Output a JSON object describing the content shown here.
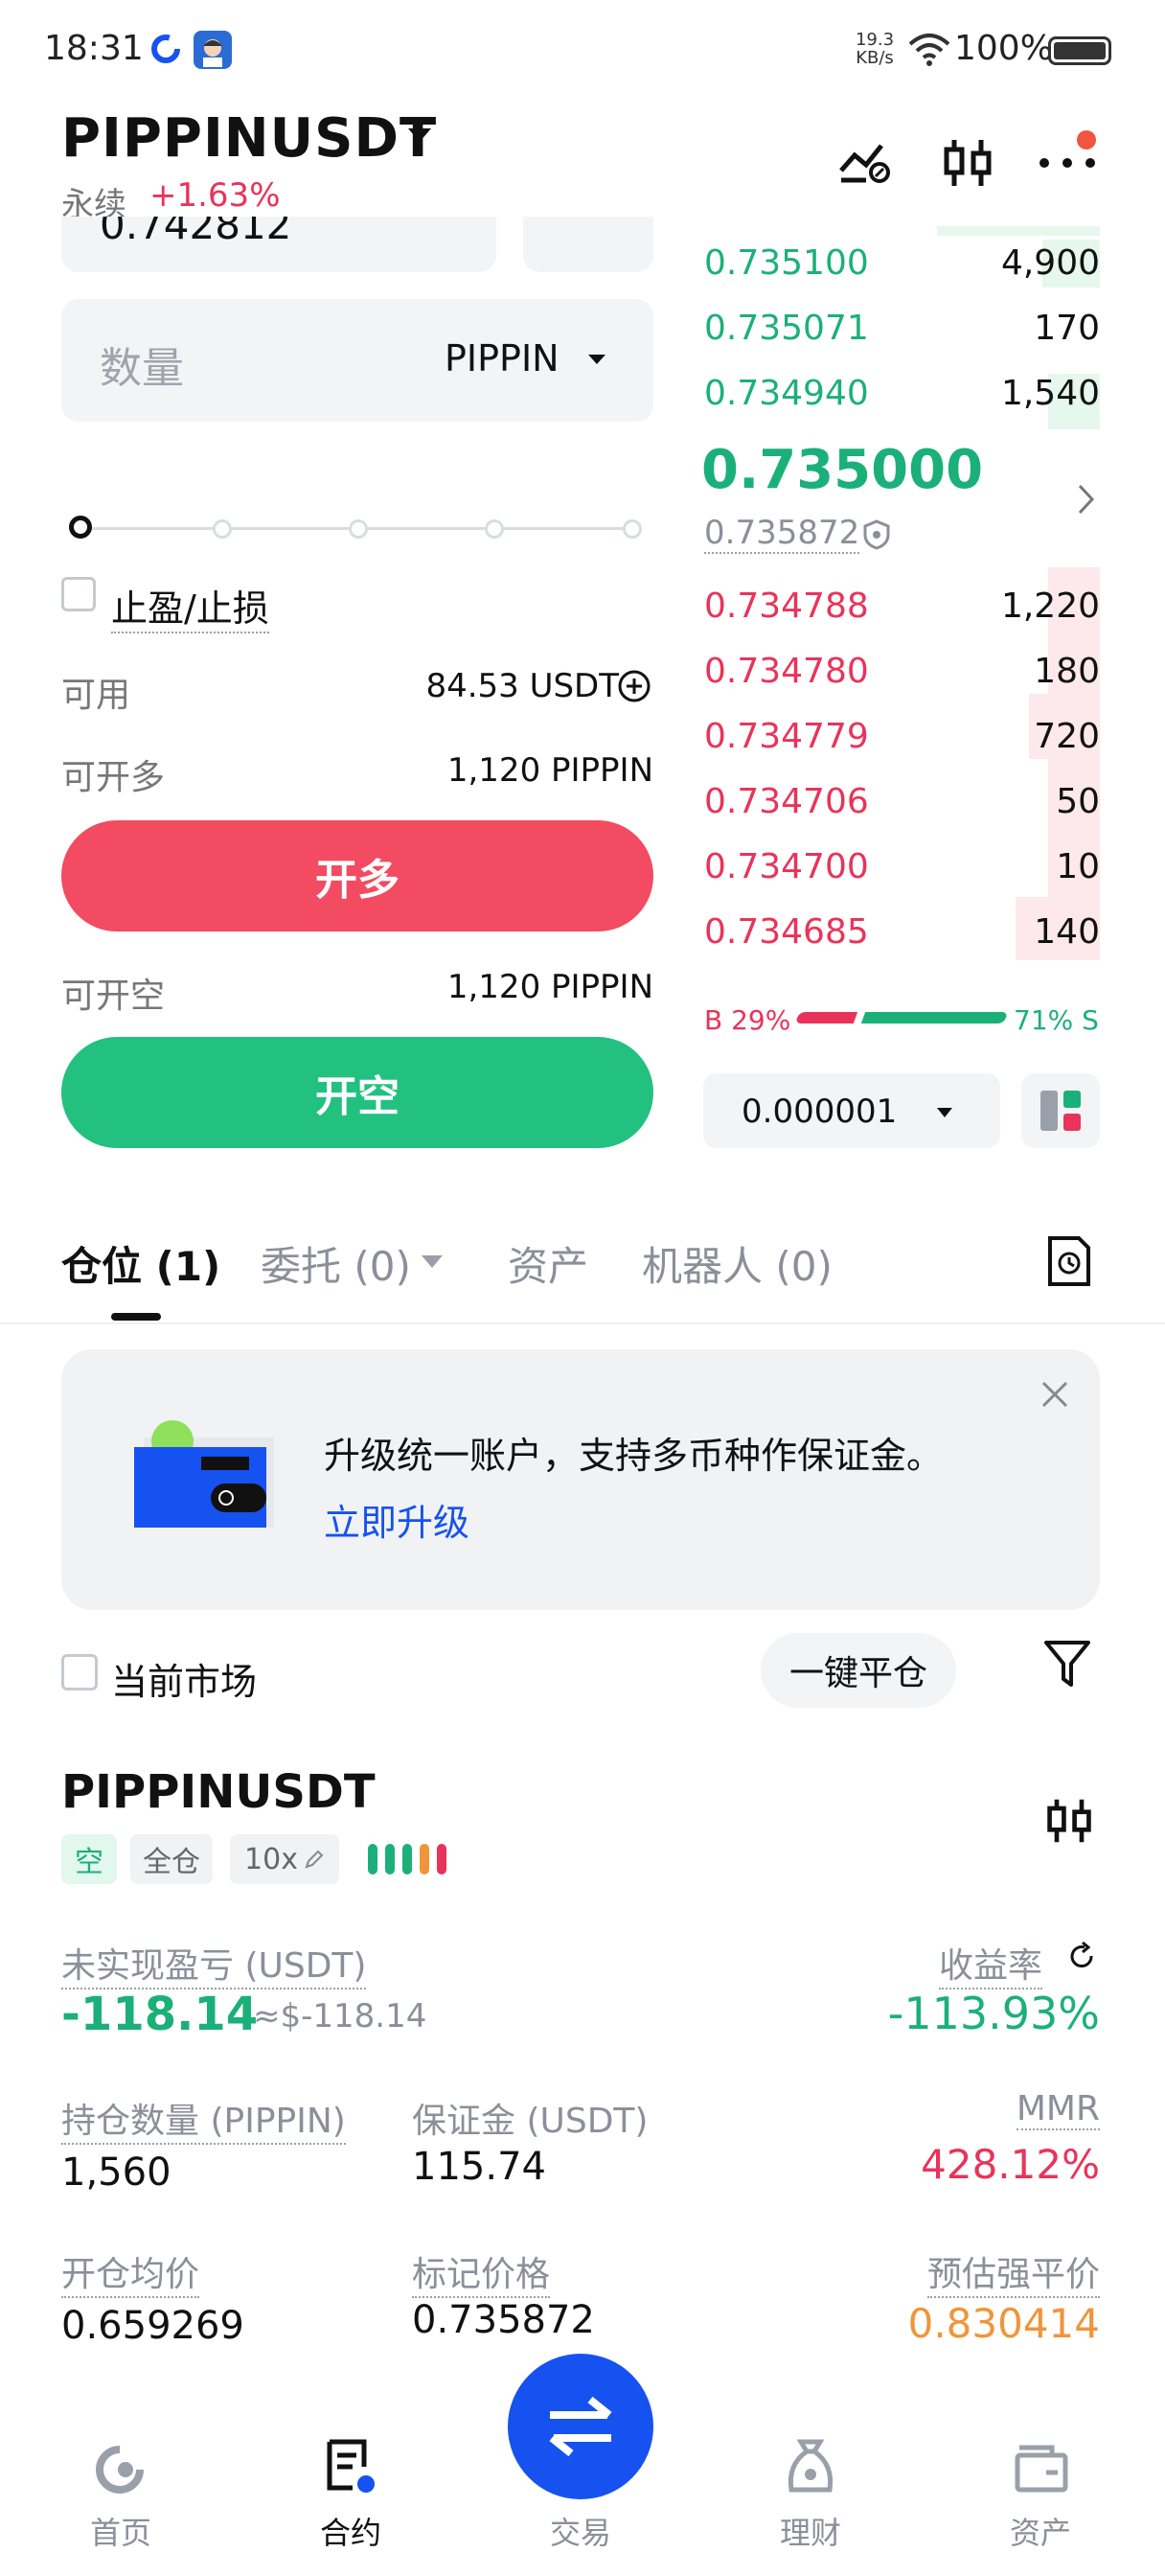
{
  "status": {
    "time": "18:31",
    "speed_top": "19.3",
    "speed_unit": "KB/s",
    "battery": "100%"
  },
  "header": {
    "pair": "PIPPINUSDT",
    "perp_label": "永续",
    "change": "+1.63%"
  },
  "form": {
    "price_partial": "0.742812",
    "qty_placeholder": "数量",
    "qty_unit": "PIPPIN",
    "tpsl_label": "止盈/止损",
    "available_label": "可用",
    "available_value": "84.53 USDT",
    "can_long_label": "可开多",
    "can_long_value": "1,120 PIPPIN",
    "long_button": "开多",
    "can_short_label": "可开空",
    "can_short_value": "1,120 PIPPIN",
    "short_button": "开空"
  },
  "orderbook": {
    "asks": [
      {
        "price": "0.735100",
        "amount": "4,900"
      },
      {
        "price": "0.735071",
        "amount": "170"
      },
      {
        "price": "0.734940",
        "amount": "1,540"
      }
    ],
    "last_price": "0.735000",
    "mark_price": "0.735872",
    "bids": [
      {
        "price": "0.734788",
        "amount": "1,220"
      },
      {
        "price": "0.734780",
        "amount": "180"
      },
      {
        "price": "0.734779",
        "amount": "720"
      },
      {
        "price": "0.734706",
        "amount": "50"
      },
      {
        "price": "0.734700",
        "amount": "10"
      },
      {
        "price": "0.734685",
        "amount": "140"
      }
    ],
    "buy_ratio": "B 29%",
    "sell_ratio": "71% S",
    "buy_fraction": 0.29,
    "precision": "0.000001"
  },
  "tabs": {
    "positions": "仓位 (1)",
    "orders": "委托 (0)",
    "assets": "资产",
    "bots": "机器人 (0)"
  },
  "banner": {
    "text": "升级统一账户，支持多币种作保证金。",
    "link": "立即升级"
  },
  "filter": {
    "current_market": "当前市场",
    "close_all": "一键平仓"
  },
  "position": {
    "symbol": "PIPPINUSDT",
    "side": "空",
    "mode": "全仓",
    "leverage": "10x",
    "upl_label": "未实现盈亏 (USDT)",
    "upl_value": "-118.14",
    "upl_usd": "≈$-118.14",
    "roe_label": "收益率",
    "roe_value": "-113.93%",
    "size_label": "持仓数量 (PIPPIN)",
    "size_value": "1,560",
    "margin_label": "保证金 (USDT)",
    "margin_value": "115.74",
    "mmr_label": "MMR",
    "mmr_value": "428.12%",
    "entry_label": "开仓均价",
    "entry_value": "0.659269",
    "mark_label": "标记价格",
    "mark_value": "0.735872",
    "liq_label": "预估强平价",
    "liq_value": "0.830414"
  },
  "nav": {
    "home": "首页",
    "futures": "合约",
    "trade": "交易",
    "earn": "理财",
    "assets": "资产"
  },
  "colors": {
    "green": "#1bb07a",
    "red": "#e8345a",
    "orange": "#f0953a",
    "blue": "#1652f0"
  }
}
